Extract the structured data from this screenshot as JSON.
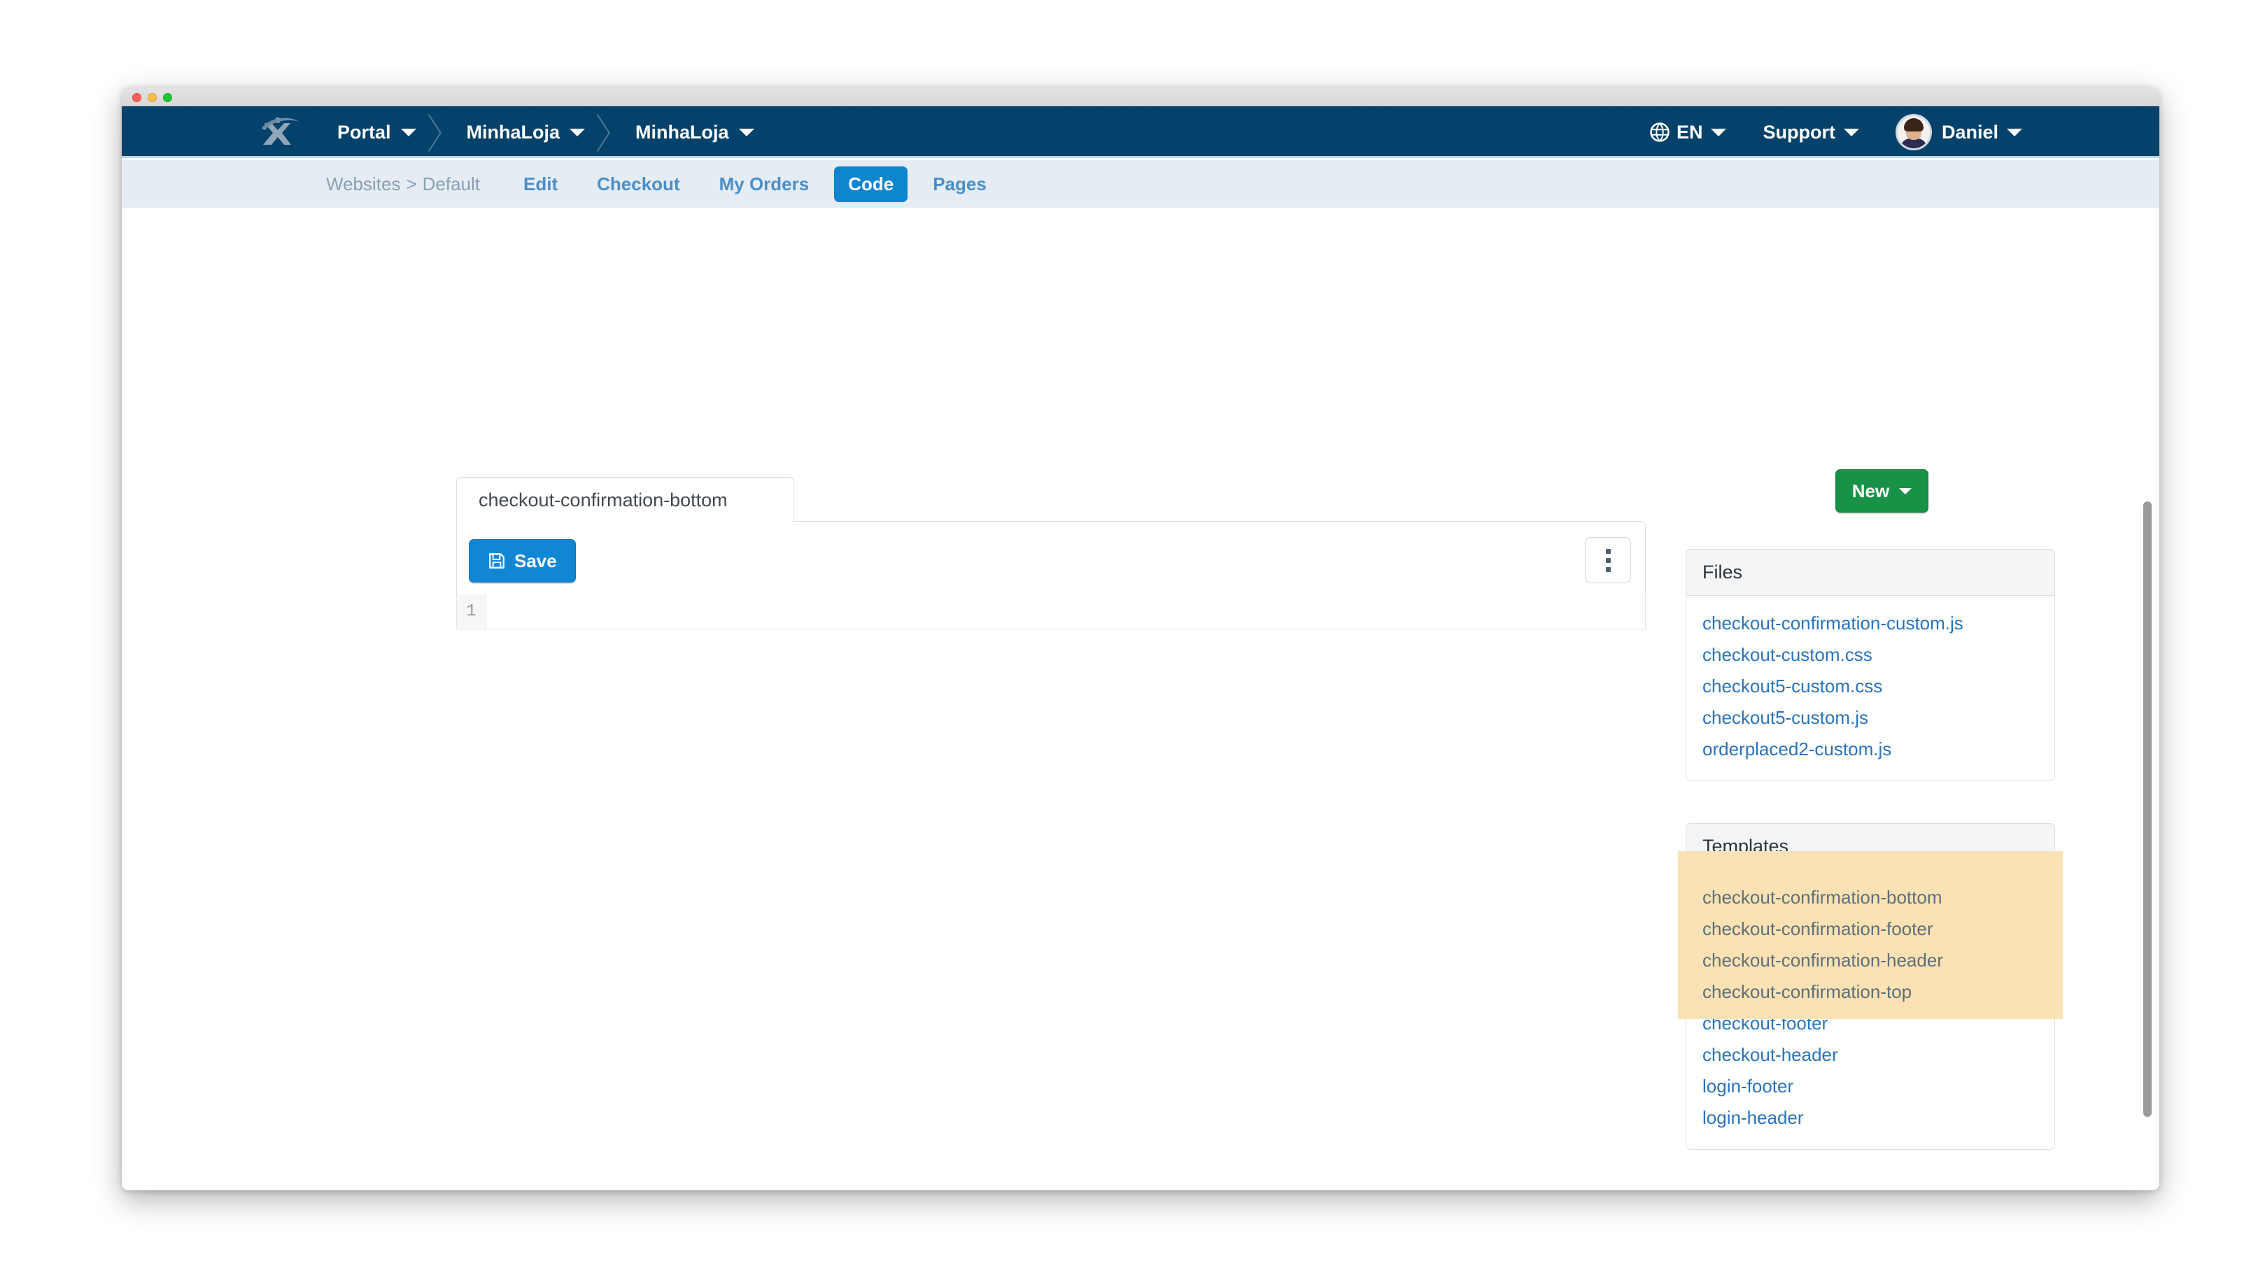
{
  "window": {
    "traffic_lights": [
      "close",
      "minimize",
      "zoom"
    ]
  },
  "topnav": {
    "logo_name": "x-brand-logo",
    "crumbs": [
      {
        "label": "Portal"
      },
      {
        "label": "MinhaLoja"
      },
      {
        "label": "MinhaLoja"
      }
    ],
    "language": "EN",
    "support": "Support",
    "user": "Daniel"
  },
  "subnav": {
    "breadcrumb_root": "Websites",
    "breadcrumb_sep": ">",
    "breadcrumb_leaf": "Default",
    "tabs": [
      {
        "label": "Edit",
        "active": false
      },
      {
        "label": "Checkout",
        "active": false
      },
      {
        "label": "My Orders",
        "active": false
      },
      {
        "label": "Code",
        "active": true
      },
      {
        "label": "Pages",
        "active": false
      }
    ]
  },
  "toolbar": {
    "new_label": "New"
  },
  "editor": {
    "tab_label": "checkout-confirmation-bottom",
    "save_label": "Save",
    "kebab_label": "More options",
    "line_number": "1",
    "content": ""
  },
  "files_panel": {
    "title": "Files",
    "items": [
      "checkout-confirmation-custom.js",
      "checkout-custom.css",
      "checkout5-custom.css",
      "checkout5-custom.js",
      "orderplaced2-custom.js"
    ]
  },
  "templates_panel": {
    "title": "Templates",
    "items": [
      {
        "label": "checkout-confirmation-bottom",
        "selected": true
      },
      {
        "label": "checkout-confirmation-footer",
        "selected": true
      },
      {
        "label": "checkout-confirmation-header",
        "selected": true
      },
      {
        "label": "checkout-confirmation-top",
        "selected": true
      },
      {
        "label": "checkout-footer",
        "selected": false
      },
      {
        "label": "checkout-header",
        "selected": false
      },
      {
        "label": "login-footer",
        "selected": false
      },
      {
        "label": "login-header",
        "selected": false
      }
    ]
  },
  "colors": {
    "navy": "#05426b",
    "subnav_bg": "#e6ecf3",
    "accent_blue": "#0d86d0",
    "link_blue": "#2a74bb",
    "green": "#179247",
    "selection_amber": "#fae2b4"
  }
}
